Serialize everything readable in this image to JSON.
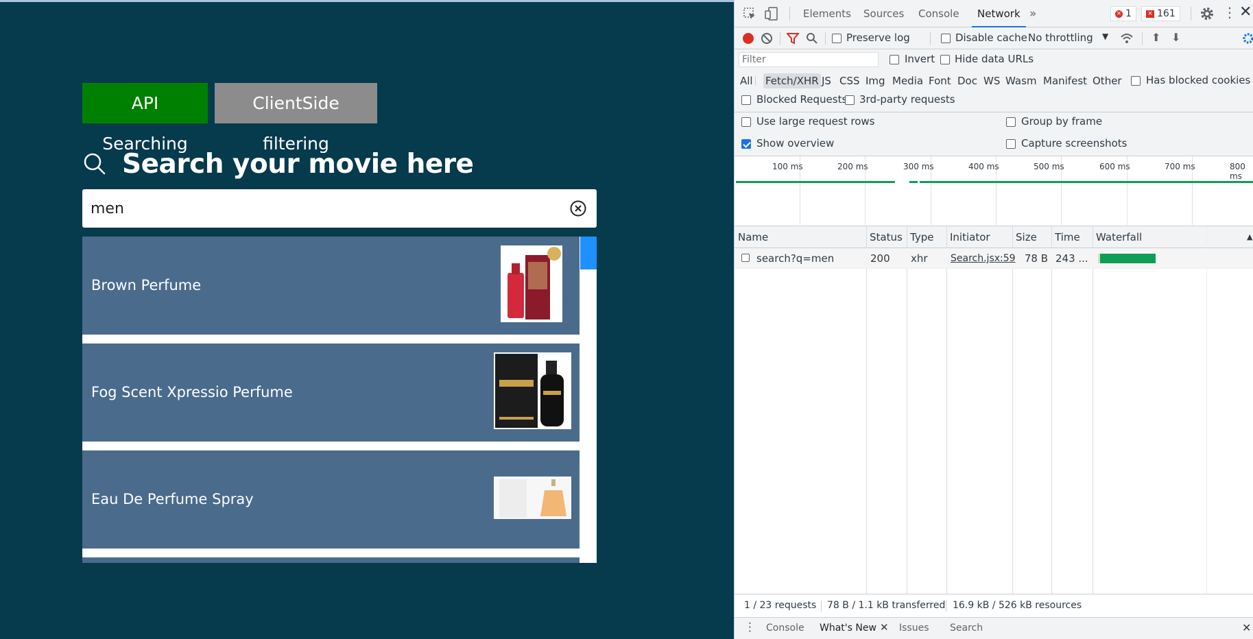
{
  "app": {
    "mode_buttons": {
      "api": "API Searching",
      "client": "ClientSide filtering"
    },
    "search_title": "Search your movie here",
    "search_value": "men",
    "results": [
      {
        "label": "Brown Perfume"
      },
      {
        "label": "Fog Scent Xpressio Perfume"
      },
      {
        "label": "Eau De Perfume Spray"
      }
    ],
    "colors": {
      "background": "#063a4d",
      "api_button": "#008000",
      "client_button": "#8c8c8c",
      "result": "#4a6b8c",
      "scroll": "#1e90ff"
    }
  },
  "devtools": {
    "tabs": [
      "Elements",
      "Sources",
      "Console",
      "Network"
    ],
    "active_tab": "Network",
    "errors": "1",
    "warnings": "161",
    "toolbar": {
      "preserve_log": "Preserve log",
      "disable_cache": "Disable cache",
      "throttling": "No throttling"
    },
    "filter": {
      "placeholder": "Filter",
      "invert": "Invert",
      "hide_data_urls": "Hide data URLs"
    },
    "types": [
      "All",
      "Fetch/XHR",
      "JS",
      "CSS",
      "Img",
      "Media",
      "Font",
      "Doc",
      "WS",
      "Wasm",
      "Manifest",
      "Other"
    ],
    "active_type": "Fetch/XHR",
    "has_blocked_cookies": "Has blocked cookies",
    "blocked_requests": "Blocked Requests",
    "third_party": "3rd-party requests",
    "settings": {
      "large_rows": "Use large request rows",
      "group_by_frame": "Group by frame",
      "show_overview": "Show overview",
      "capture_screenshots": "Capture screenshots"
    },
    "overview_ticks": [
      "100 ms",
      "200 ms",
      "300 ms",
      "400 ms",
      "500 ms",
      "600 ms",
      "700 ms",
      "800 ms"
    ],
    "columns": [
      "Name",
      "Status",
      "Type",
      "Initiator",
      "Size",
      "Time",
      "Waterfall"
    ],
    "request": {
      "name": "search?q=men",
      "status": "200",
      "type": "xhr",
      "initiator": "Search.jsx:59",
      "size": "78 B",
      "time": "243 ..."
    },
    "status_bar": {
      "requests": "1 / 23 requests",
      "transferred": "78 B / 1.1 kB transferred",
      "resources": "16.9 kB / 526 kB resources"
    },
    "drawer_tabs": {
      "console": "Console",
      "whats_new": "What's New",
      "issues": "Issues",
      "search": "Search"
    }
  }
}
